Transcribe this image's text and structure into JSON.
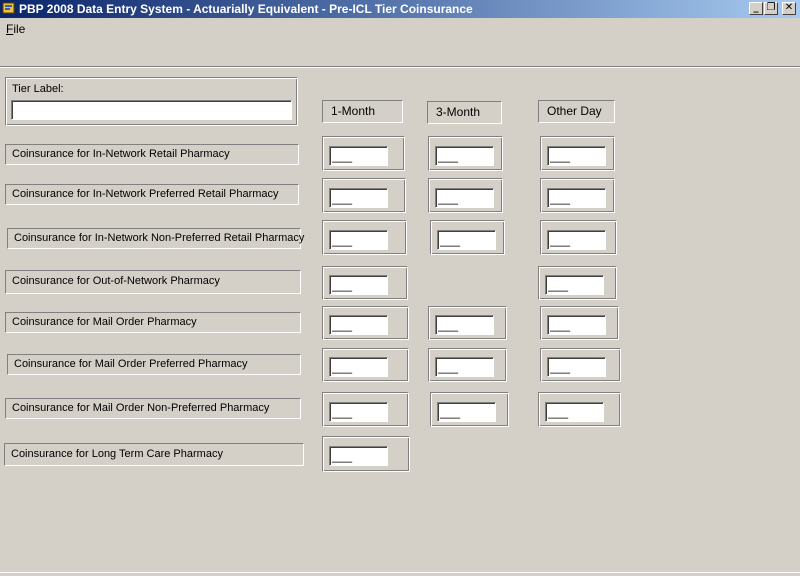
{
  "window": {
    "title": "PBP 2008 Data Entry System - Actuarially Equivalent - Pre-ICL Tier Coinsurance",
    "minimize": "_",
    "restore": "❐",
    "close": "✕"
  },
  "menu": {
    "file_accel": "F",
    "file_rest": "ile"
  },
  "tier": {
    "label": "Tier Label:",
    "value": ""
  },
  "columns": [
    "1-Month",
    "3-Month",
    "Other Day"
  ],
  "rows": [
    {
      "label": "Coinsurance for In-Network Retail Pharmacy",
      "one_month": "___",
      "three_month": "___",
      "other_day": "___"
    },
    {
      "label": "Coinsurance for In-Network Preferred Retail Pharmacy",
      "one_month": "___",
      "three_month": "___",
      "other_day": "___"
    },
    {
      "label": "Coinsurance for In-Network Non-Preferred Retail Pharmacy",
      "one_month": "___",
      "three_month": "___",
      "other_day": "___"
    },
    {
      "label": "Coinsurance for Out-of-Network Pharmacy",
      "one_month": "___",
      "other_day": "___"
    },
    {
      "label": "Coinsurance for Mail Order Pharmacy",
      "one_month": "___",
      "three_month": "___",
      "other_day": "___"
    },
    {
      "label": "Coinsurance for Mail Order Preferred Pharmacy",
      "one_month": "___",
      "three_month": "___",
      "other_day": "___"
    },
    {
      "label": "Coinsurance for Mail Order Non-Preferred Pharmacy",
      "one_month": "___",
      "three_month": "___",
      "other_day": "___"
    },
    {
      "label": "Coinsurance for Long Term Care Pharmacy",
      "one_month": "___"
    }
  ]
}
